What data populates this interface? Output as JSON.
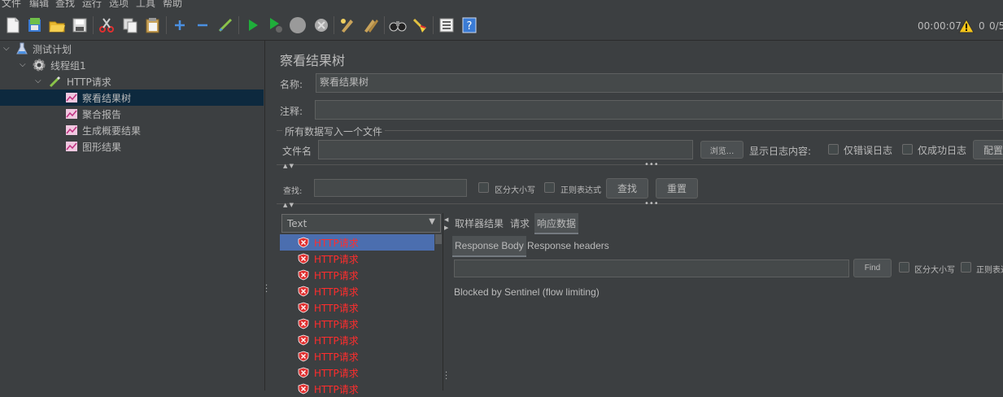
{
  "menu": [
    "文件",
    "编辑",
    "查找",
    "运行",
    "选项",
    "工具",
    "帮助"
  ],
  "status": {
    "timer": "00:00:07",
    "warnings": "0",
    "threads": "0/5"
  },
  "tree": {
    "plan": "测试计划",
    "thread_group": "线程组1",
    "sampler": "HTTP请求",
    "listeners": [
      "察看结果树",
      "聚合报告",
      "生成概要结果",
      "图形结果"
    ]
  },
  "panel": {
    "title": "察看结果树",
    "name_label": "名称:",
    "name_value": "察看结果树",
    "comment_label": "注释:",
    "comment_value": "",
    "file_section": "所有数据写入一个文件",
    "filename_label": "文件名",
    "filename_value": "",
    "browse": "浏览...",
    "log_label": "显示日志内容:",
    "errors_only": "仅错误日志",
    "success_only": "仅成功日志",
    "configure": "配置"
  },
  "search": {
    "label": "查找:",
    "value": "",
    "case": "区分大小写",
    "regex": "正则表达式",
    "find": "查找",
    "reset": "重置"
  },
  "results": {
    "renderer": "Text",
    "items": [
      "HTTP请求",
      "HTTP请求",
      "HTTP请求",
      "HTTP请求",
      "HTTP请求",
      "HTTP请求",
      "HTTP请求",
      "HTTP请求",
      "HTTP请求",
      "HTTP请求"
    ],
    "tabs": [
      "取样器结果",
      "请求",
      "响应数据"
    ],
    "subtabs": [
      "Response Body",
      "Response headers"
    ],
    "find_value": "",
    "find_btn": "Find",
    "case": "区分大小写",
    "regex": "正则表达式",
    "body": "Blocked by Sentinel (flow limiting)"
  }
}
